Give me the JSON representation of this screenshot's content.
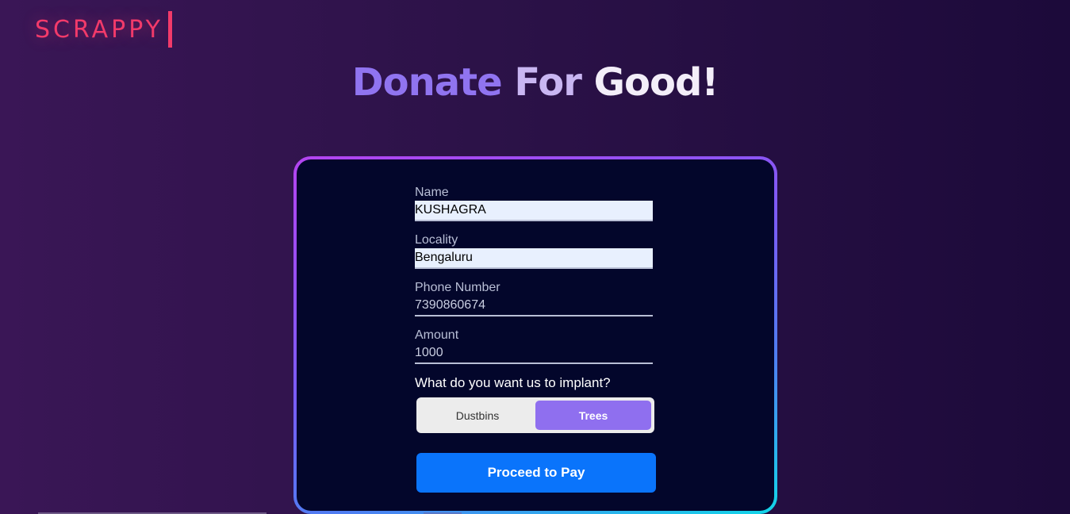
{
  "brand": {
    "name": "SCRAPPY",
    "color": "#f23a6a"
  },
  "headline": {
    "part1": "Donate",
    "part2": "For",
    "part3": "Good!"
  },
  "form": {
    "name": {
      "label": "Name",
      "value": "KUSHAGRA"
    },
    "locality": {
      "label": "Locality",
      "value": "Bengaluru"
    },
    "phone": {
      "label": "Phone Number",
      "value": "7390860674"
    },
    "amount": {
      "label": "Amount",
      "value": "1000"
    },
    "implant": {
      "question": "What do you want us to implant?",
      "options": [
        "Dustbins",
        "Trees"
      ],
      "selected": "Trees"
    },
    "submit_label": "Proceed to Pay"
  },
  "colors": {
    "card_background": "#03062b",
    "toggle_active": "#8f6fef",
    "submit_button": "#0a74fb"
  }
}
